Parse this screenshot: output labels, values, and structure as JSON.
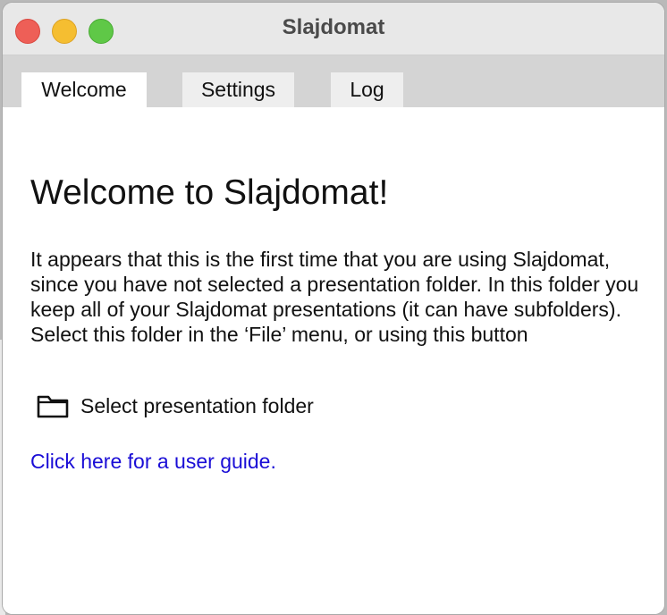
{
  "window": {
    "title": "Slajdomat",
    "controls": [
      "close",
      "minimize",
      "zoom"
    ]
  },
  "tabs": [
    {
      "label": "Welcome",
      "active": true
    },
    {
      "label": "Settings",
      "active": false
    },
    {
      "label": "Log",
      "active": false
    }
  ],
  "welcome": {
    "heading": "Welcome to Slajdomat!",
    "body": "It appears that this is the first time that you are using Slajdomat, since you have not selected a presentation folder. In this folder you keep all of your Slajdomat presentations (it can have subfolders). Select this folder in the ‘File’  menu, or using this button",
    "folder_button": {
      "label": "Select presentation folder",
      "icon": "folder-icon"
    },
    "guide_link": "Click here for a user guide."
  },
  "colors": {
    "link": "#1a0dd6",
    "close": "#ee5f57",
    "minimize": "#f5be31",
    "zoom": "#5fc847"
  }
}
